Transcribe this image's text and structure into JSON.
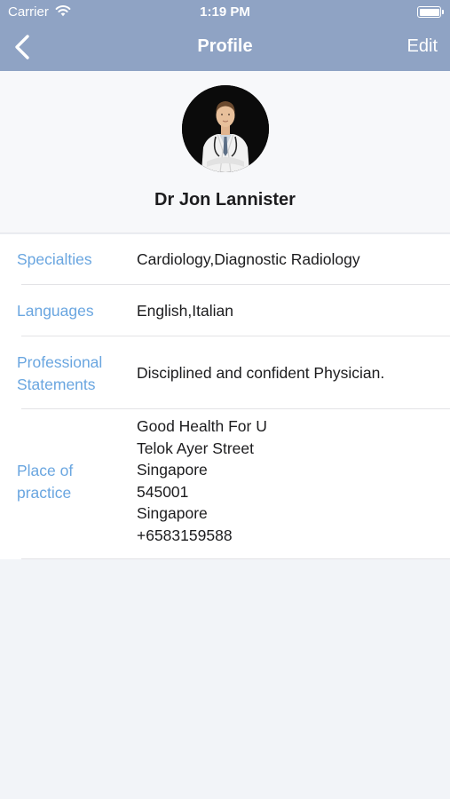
{
  "status_bar": {
    "carrier": "Carrier",
    "time": "1:19 PM"
  },
  "nav": {
    "title": "Profile",
    "edit_label": "Edit",
    "back_icon": "chevron-left-icon"
  },
  "profile": {
    "name": "Dr Jon Lannister",
    "avatar_bg": "#0b0b0b"
  },
  "details": {
    "specialties": {
      "label": "Specialties",
      "value": "Cardiology,Diagnostic Radiology"
    },
    "languages": {
      "label": "Languages",
      "value": "English,Italian"
    },
    "statements": {
      "label_line1": "Professional",
      "label_line2": "Statements",
      "value": "Disciplined and confident Physician."
    },
    "place": {
      "label_line1": "Place of",
      "label_line2": "practice",
      "lines": [
        "Good Health For U",
        "Telok Ayer Street",
        "Singapore",
        "545001",
        "Singapore",
        "+6583159588"
      ]
    }
  },
  "colors": {
    "nav_bar": "#8fa3c4",
    "label_blue": "#6aa6e0",
    "background": "#f2f4f8"
  }
}
